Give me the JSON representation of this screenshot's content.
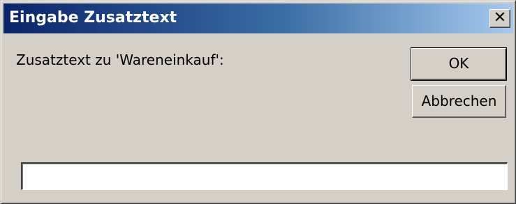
{
  "window": {
    "title": "Eingabe Zusatztext",
    "close_glyph": "✕"
  },
  "dialog": {
    "prompt": "Zusatztext zu 'Wareneinkauf':",
    "ok_label": "OK",
    "cancel_label": "Abbrechen",
    "input_value": ""
  },
  "colors": {
    "titlebar_start": "#0a246a",
    "titlebar_end": "#a6caf0",
    "face": "#d4d0c8"
  },
  "icons": {
    "close": "close-icon"
  }
}
